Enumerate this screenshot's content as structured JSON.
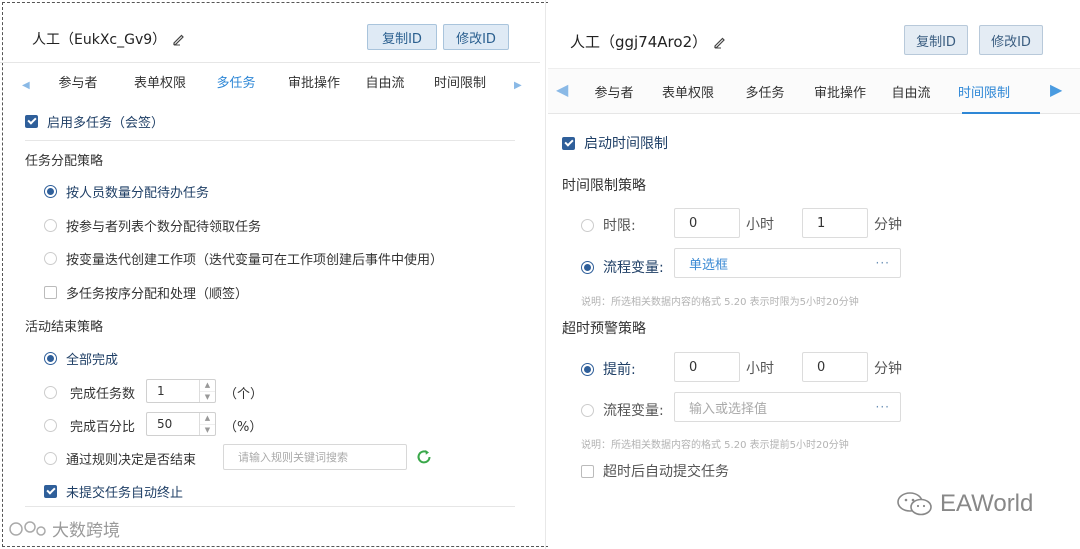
{
  "left": {
    "title": "人工（EukXc_Gv9）",
    "copy_id": "复制ID",
    "edit_id": "修改ID",
    "tabs": [
      "参与者",
      "表单权限",
      "多任务",
      "审批操作",
      "自由流",
      "时间限制"
    ],
    "active_tab": "多任务",
    "enable_multi": "启用多任务（会签）",
    "assign_title": "任务分配策略",
    "assign_options": [
      "按人员数量分配待办任务",
      "按参与者列表个数分配待领取任务",
      "按变量迭代创建工作项（迭代变量可在工作项创建后事件中使用）"
    ],
    "sequential": "多任务按序分配和处理（顺签）",
    "end_title": "活动结束策略",
    "end_all": "全部完成",
    "end_count": "完成任务数",
    "end_count_value": "1",
    "end_count_unit": "（个）",
    "end_percent": "完成百分比",
    "end_percent_value": "50",
    "end_percent_unit": "（%）",
    "end_rule": "通过规则决定是否结束",
    "rule_placeholder": "请输入规则关键词搜索",
    "auto_terminate": "未提交任务自动终止"
  },
  "right": {
    "title": "人工（ggj74Aro2）",
    "copy_id": "复制ID",
    "edit_id": "修改ID",
    "tabs": [
      "参与者",
      "表单权限",
      "多任务",
      "审批操作",
      "自由流",
      "时间限制"
    ],
    "active_tab": "时间限制",
    "enable_time": "启动时间限制",
    "strategy_title": "时间限制策略",
    "limit_label": "时限:",
    "limit_hours": "0",
    "hour_unit": "小时",
    "limit_minutes": "1",
    "minute_unit": "分钟",
    "flow_var_label": "流程变量:",
    "flow_var_value": "单选框",
    "hint1": "说明：所选相关数据内容的格式 5.20 表示时限为5小时20分钟",
    "warn_title": "超时预警策略",
    "advance_label": "提前:",
    "advance_hours": "0",
    "advance_minutes": "0",
    "flow_var_label2": "流程变量:",
    "flow_var_placeholder": "输入或选择值",
    "hint2": "说明：所选相关数据内容的格式 5.20 表示提前5小时20分钟",
    "auto_submit": "超时后自动提交任务",
    "dots": "···"
  },
  "watermarks": {
    "left": "大数跨境",
    "right": "EAWorld"
  },
  "colors": {
    "accent": "#2e87d6",
    "check": "#2f5f9a"
  }
}
